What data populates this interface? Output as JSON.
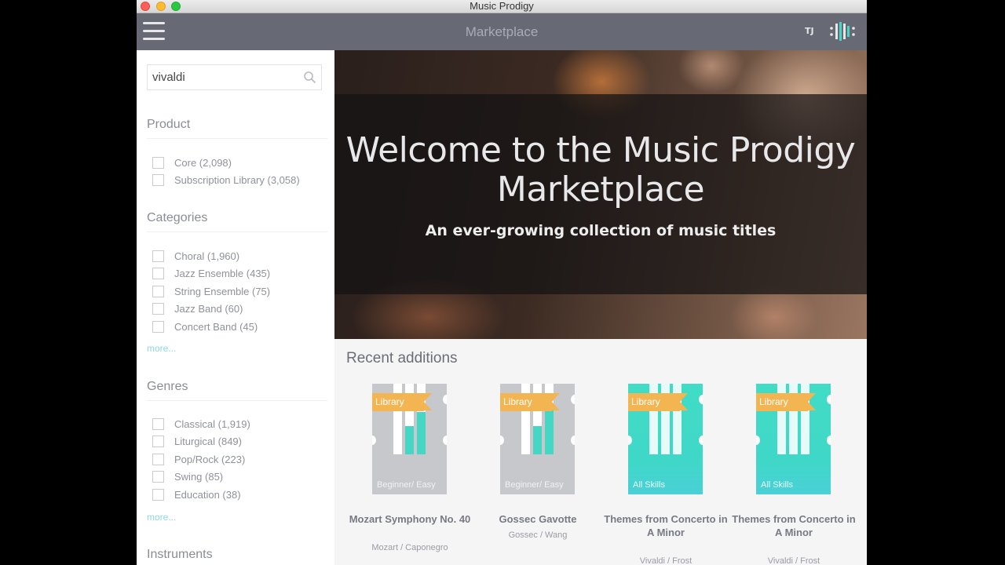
{
  "window": {
    "title": "Music Prodigy"
  },
  "appbar": {
    "title": "Marketplace",
    "user_initials": "TJ"
  },
  "search": {
    "value": "vivaldi",
    "placeholder": ""
  },
  "facets": {
    "product": {
      "title": "Product",
      "items": [
        "Core (2,098)",
        "Subscription Library (3,058)"
      ]
    },
    "categories": {
      "title": "Categories",
      "items": [
        "Choral (1,960)",
        "Jazz Ensemble (435)",
        "String Ensemble (75)",
        "Jazz Band (60)",
        "Concert Band (45)"
      ],
      "more": "more..."
    },
    "genres": {
      "title": "Genres",
      "items": [
        "Classical (1,919)",
        "Liturgical (849)",
        "Pop/Rock (223)",
        "Swing (85)",
        "Education (38)"
      ],
      "more": "more..."
    },
    "instruments": {
      "title": "Instruments"
    }
  },
  "hero": {
    "heading": "Welcome to the Music Prodigy Marketplace",
    "subheading": "An ever-growing collection of music titles"
  },
  "recent": {
    "title": "Recent additions",
    "cards": [
      {
        "ribbon": "Library",
        "skill": "Beginner/ Easy",
        "title": "Mozart Symphony No. 40",
        "subtitle": "Mozart / Caponegro",
        "style": "gray",
        "fills": [
          0,
          0.4,
          0.6
        ]
      },
      {
        "ribbon": "Library",
        "skill": "Beginner/ Easy",
        "title": "Gossec Gavotte",
        "subtitle": "Gossec / Wang",
        "style": "gray",
        "fills": [
          0,
          0.4,
          0.7
        ]
      },
      {
        "ribbon": "Library",
        "skill": "All Skills",
        "title": "Themes from Concerto in A Minor",
        "subtitle": "Vivaldi / Frost",
        "style": "teal",
        "fills": [
          1,
          1,
          1
        ]
      },
      {
        "ribbon": "Library",
        "skill": "All Skills",
        "title": "Themes from Concerto in A Minor",
        "subtitle": "Vivaldi / Frost",
        "style": "teal",
        "fills": [
          1,
          1,
          1
        ]
      }
    ]
  },
  "colors": {
    "appbar": "#676a74",
    "accent_teal": "#41dcc6",
    "ribbon": "#f2b552",
    "link": "#8ed9de"
  },
  "icons": {
    "menu": "hamburger-icon",
    "search": "search-icon",
    "logo": "music-prodigy-logo-icon"
  }
}
